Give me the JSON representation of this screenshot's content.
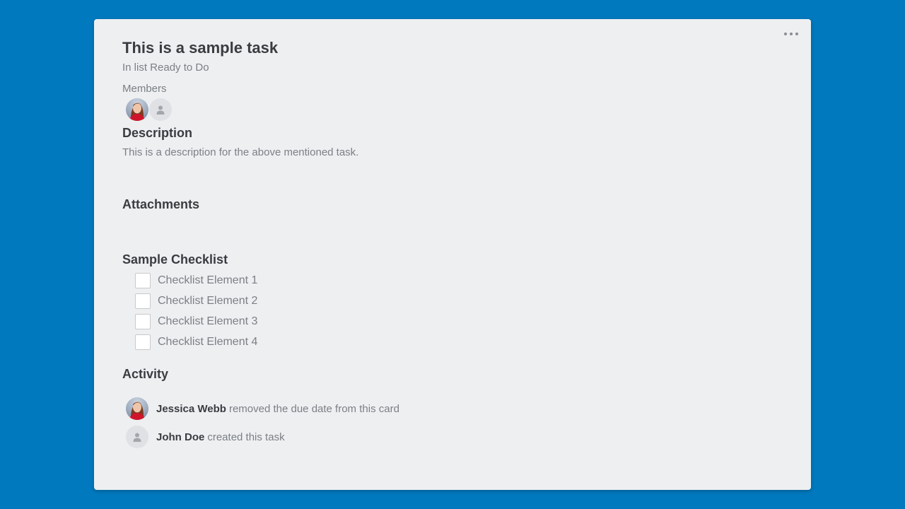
{
  "card": {
    "title": "This is a sample task",
    "subtitle": "In list Ready to Do",
    "menu_icon": "more-horizontal-icon"
  },
  "members": {
    "label": "Members",
    "avatars": [
      {
        "icon": "user-photo-avatar"
      },
      {
        "icon": "default-user-avatar"
      }
    ]
  },
  "description": {
    "heading": "Description",
    "text": "This is a description for the above mentioned task."
  },
  "attachments": {
    "heading": "Attachments"
  },
  "checklist": {
    "heading": "Sample Checklist",
    "items": [
      {
        "label": "Checklist Element 1",
        "checked": false
      },
      {
        "label": "Checklist Element 2",
        "checked": false
      },
      {
        "label": "Checklist Element 3",
        "checked": false
      },
      {
        "label": "Checklist Element 4",
        "checked": false
      }
    ]
  },
  "activity": {
    "heading": "Activity",
    "entries": [
      {
        "name": "Jessica Webb",
        "text": "removed the due date  from this card"
      },
      {
        "name": "John Doe",
        "text": "created  this task"
      }
    ]
  },
  "colors": {
    "background": "#0079bf",
    "card": "#edeff1",
    "heading": "#3a3c40",
    "muted": "#7c7f84"
  }
}
